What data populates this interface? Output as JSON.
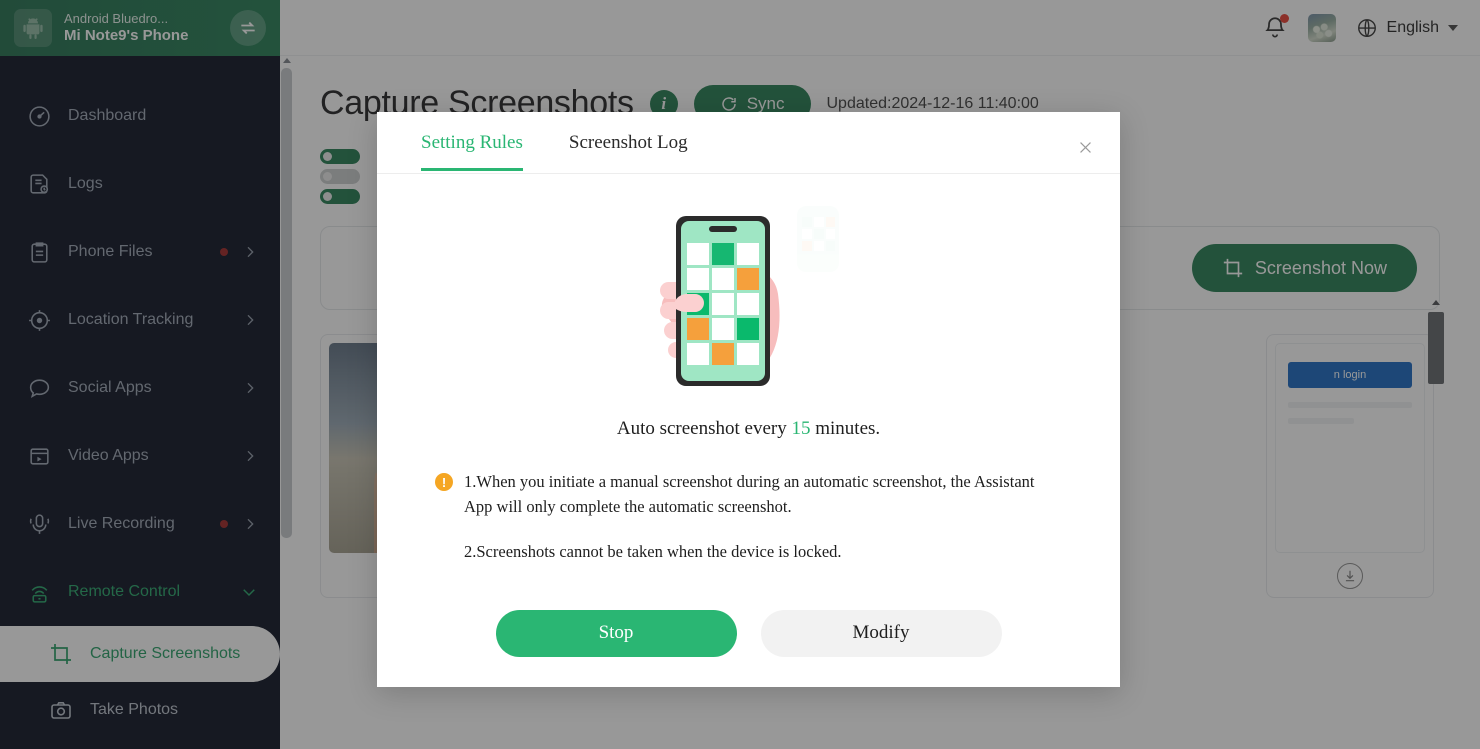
{
  "sidebar": {
    "device_label": "Android Bluedro...",
    "phone_name": "Mi Note9's Phone",
    "switch_icon": "switch-device-icon",
    "logo_icon": "android-robot-icon",
    "items": [
      {
        "label": "Dashboard",
        "icon": "dashboard-gauge-icon",
        "dot": false,
        "chevron": "none"
      },
      {
        "label": "Logs",
        "icon": "logs-document-icon",
        "dot": false,
        "chevron": "none"
      },
      {
        "label": "Phone Files",
        "icon": "phone-files-clipboard-icon",
        "dot": true,
        "chevron": "right"
      },
      {
        "label": "Location Tracking",
        "icon": "location-target-icon",
        "dot": false,
        "chevron": "right"
      },
      {
        "label": "Social Apps",
        "icon": "chat-bubble-icon",
        "dot": false,
        "chevron": "right"
      },
      {
        "label": "Video Apps",
        "icon": "video-clapper-icon",
        "dot": false,
        "chevron": "right"
      },
      {
        "label": "Live Recording",
        "icon": "microphone-icon",
        "dot": true,
        "chevron": "right"
      },
      {
        "label": "Remote Control",
        "icon": "remote-signal-icon",
        "dot": false,
        "chevron": "down",
        "active_group": true
      }
    ],
    "sub_items": [
      {
        "label": "Capture Screenshots",
        "icon": "crop-frame-icon",
        "selected": true
      },
      {
        "label": "Take Photos",
        "icon": "camera-icon",
        "selected": false
      }
    ]
  },
  "topbar": {
    "bell_icon": "notification-bell-icon",
    "avatar_icon": "user-avatar",
    "globe_icon": "globe-language-icon",
    "language": "English",
    "caret_icon": "chevron-down-icon"
  },
  "page": {
    "title": "Capture Screenshots",
    "info_icon": "info-icon",
    "info_char": "i",
    "sync_label": "Sync",
    "sync_icon": "refresh-icon",
    "updated_text": "Updated:2024-12-16 11:40:00",
    "screenshot_now_label": "Screenshot Now",
    "screenshot_now_icon": "crop-frame-icon",
    "thumbnail_login_button": "n login",
    "download_icon": "download-icon"
  },
  "modal": {
    "tabs": [
      {
        "label": "Setting Rules",
        "selected": true
      },
      {
        "label": "Screenshot Log",
        "selected": false
      }
    ],
    "close_icon": "close-icon",
    "illustration_icon": "hand-holding-phone-illustration",
    "auto_prefix": "Auto screenshot every",
    "auto_minutes": "15",
    "auto_suffix": "minutes.",
    "warn_icon": "warning-exclamation-icon",
    "warn_char": "!",
    "note_1": "1.When you initiate a manual screenshot during an automatic screenshot, the Assistant App will only complete the automatic screenshot.",
    "note_2": "2.Screenshots cannot be taken when the device is locked.",
    "stop_label": "Stop",
    "modify_label": "Modify"
  },
  "colors": {
    "brand_green": "#2ab673",
    "header_green": "#1f7a50",
    "sidebar_bg": "#070d1d",
    "warning_orange": "#f5a623",
    "badge_red": "#9b2020"
  }
}
